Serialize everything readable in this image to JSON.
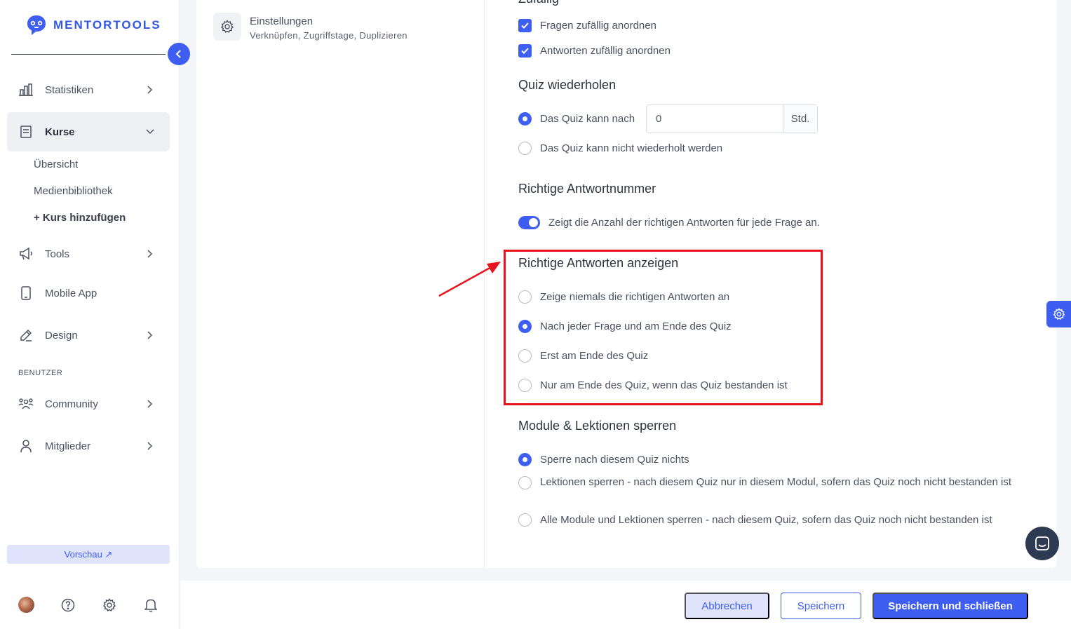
{
  "brand": {
    "name": "MENTORTOOLS",
    "color": "#3d5ef0"
  },
  "sidebar": {
    "nav": [
      {
        "label": "Statistiken",
        "icon": "bar-chart-icon"
      },
      {
        "label": "Kurse",
        "icon": "book-icon",
        "active": true
      },
      {
        "label": "Tools",
        "icon": "megaphone-icon"
      },
      {
        "label": "Mobile App",
        "icon": "phone-icon"
      },
      {
        "label": "Design",
        "icon": "edit-icon"
      },
      {
        "label": "Community",
        "icon": "community-icon"
      },
      {
        "label": "Mitglieder",
        "icon": "user-icon"
      }
    ],
    "kurse_sub": [
      "Übersicht",
      "Medienbibliothek",
      "+ Kurs hinzufügen"
    ],
    "section_label": "BENUTZER",
    "preview_label": "Vorschau ↗"
  },
  "settings_panel": {
    "title": "Einstellungen",
    "subtitle": "Verknüpfen, Zugriffstage, Duplizieren"
  },
  "zufaellig": {
    "heading": "Zufällig",
    "options": [
      "Fragen zufällig anordnen",
      "Antworten zufällig anordnen"
    ]
  },
  "quiz_wiederholen": {
    "heading": "Quiz wiederholen",
    "option_after": "Das Quiz kann nach",
    "hours_value": "0",
    "hours_unit": "Std.",
    "option_never": "Das Quiz kann nicht wiederholt werden"
  },
  "richtige_antwortnummer": {
    "heading": "Richtige Antwortnummer",
    "toggle_label": "Zeigt die Anzahl der richtigen Antworten für jede Frage an."
  },
  "richtige_antworten_anzeigen": {
    "heading": "Richtige Antworten anzeigen",
    "options": [
      "Zeige niemals die richtigen Antworten an",
      "Nach jeder Frage und am Ende des Quiz",
      "Erst am Ende des Quiz",
      "Nur am Ende des Quiz, wenn das Quiz bestanden ist"
    ],
    "selected_index": 1
  },
  "module_sperren": {
    "heading": "Module & Lektionen sperren",
    "options": [
      "Sperre nach diesem Quiz nichts",
      "Lektionen sperren - nach diesem Quiz nur in diesem Modul, sofern das Quiz noch nicht bestanden ist",
      "Alle Module und Lektionen sperren - nach diesem Quiz, sofern das Quiz noch nicht bestanden ist"
    ],
    "selected_index": 0
  },
  "footer": {
    "cancel": "Abbrechen",
    "save": "Speichern",
    "save_close": "Speichern und schließen"
  }
}
